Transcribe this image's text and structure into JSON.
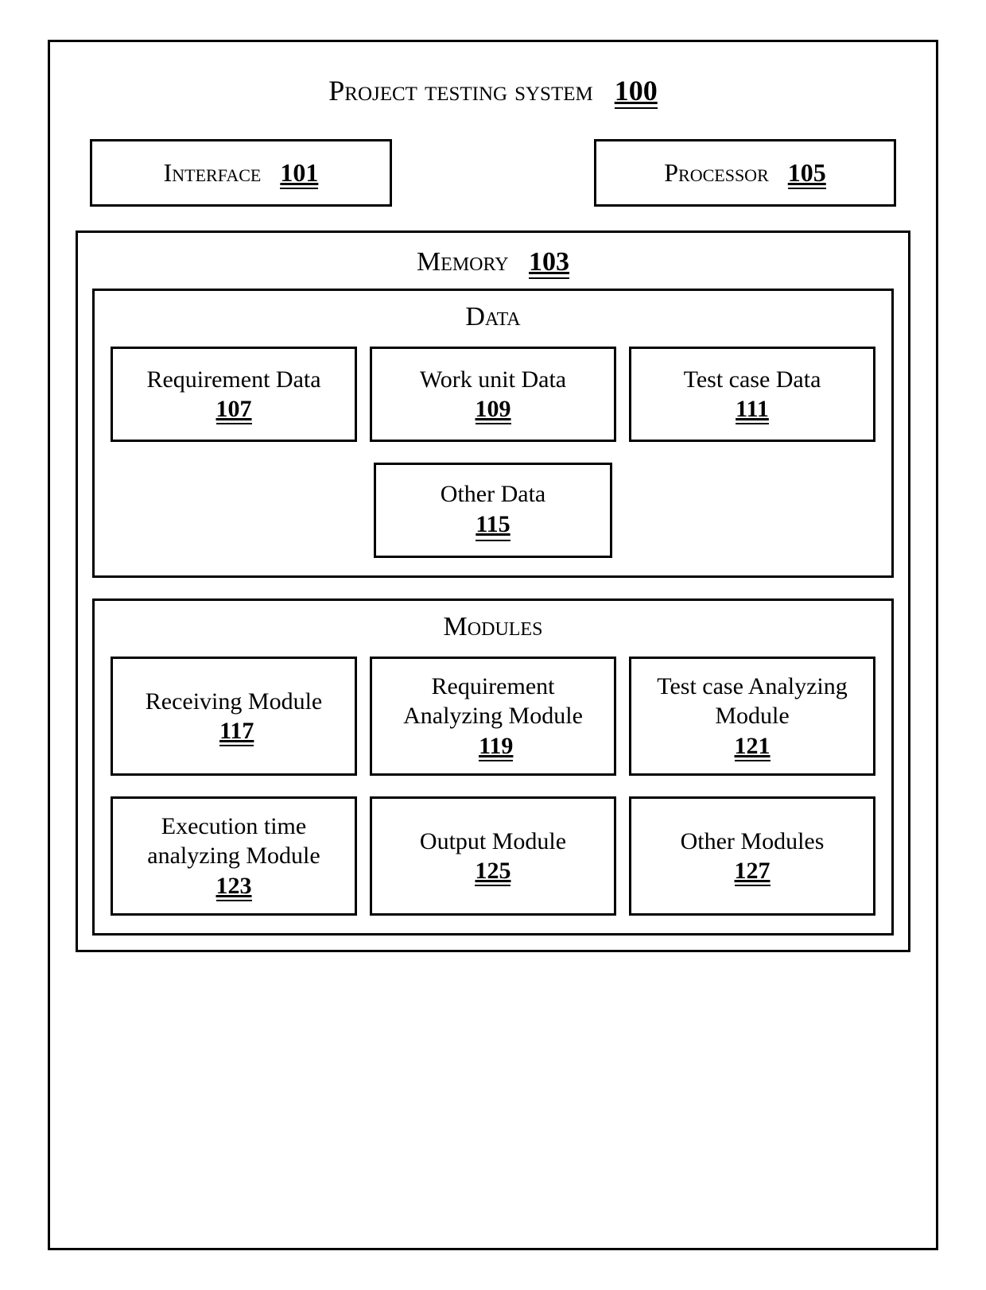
{
  "title": {
    "label": "Project testing system",
    "ref": "100"
  },
  "top": {
    "interface": {
      "label": "Interface",
      "ref": "101"
    },
    "processor": {
      "label": "Processor",
      "ref": "105"
    }
  },
  "memory": {
    "label": "Memory",
    "ref": "103",
    "data": {
      "label": "Data",
      "items": [
        {
          "label": "Requirement Data",
          "ref": "107"
        },
        {
          "label": "Work unit Data",
          "ref": "109"
        },
        {
          "label": "Test case Data",
          "ref": "111"
        }
      ],
      "other": {
        "label": "Other Data",
        "ref": "115"
      }
    },
    "modules": {
      "label": "Modules",
      "row1": [
        {
          "label": "Receiving Module",
          "ref": "117"
        },
        {
          "label": "Requirement Analyzing Module",
          "ref": "119"
        },
        {
          "label": "Test case Analyzing Module",
          "ref": "121"
        }
      ],
      "row2": [
        {
          "label": "Execution time analyzing Module",
          "ref": "123"
        },
        {
          "label": "Output Module",
          "ref": "125"
        },
        {
          "label": "Other Modules",
          "ref": "127"
        }
      ]
    }
  }
}
